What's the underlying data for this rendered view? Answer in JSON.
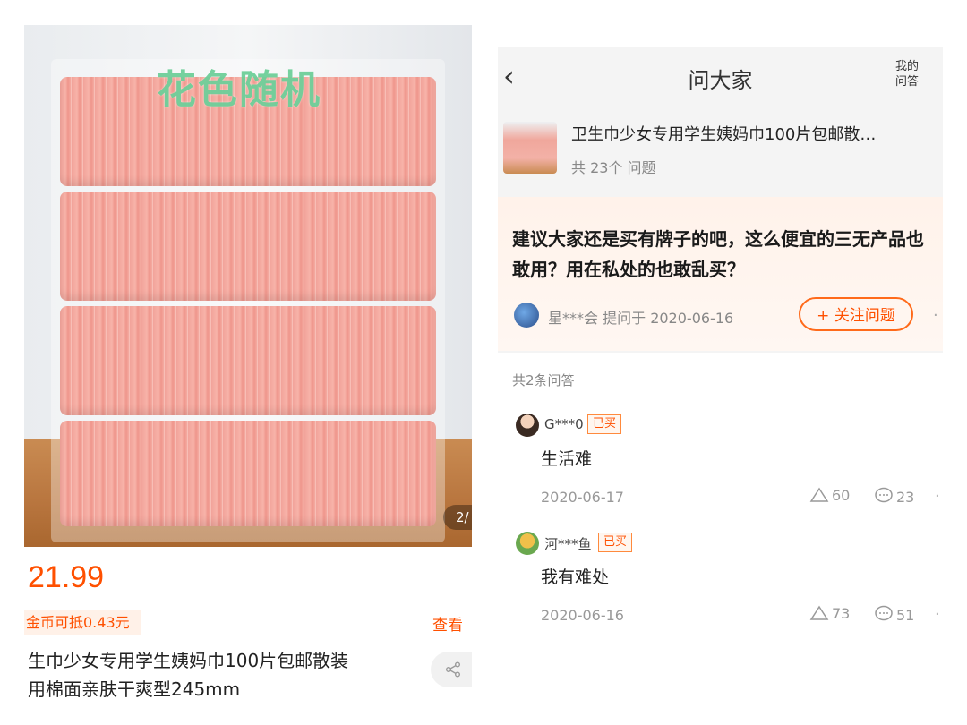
{
  "left": {
    "watermark": "花色随机",
    "page_indicator": "2/",
    "price": "21.99",
    "coin_text": "金币可抵0.43元",
    "look_all": "查看",
    "title_line1": "生巾少女专用学生姨妈巾100片包邮散装",
    "title_line2": "用棉面亲肤干爽型245mm"
  },
  "right": {
    "nav": {
      "back": "‹",
      "title": "问大家",
      "my_qa_line1": "我的",
      "my_qa_line2": "问答"
    },
    "product": {
      "title": "卫生巾少女专用学生姨妈巾100片包邮散…",
      "question_count": "共 23个 问题"
    },
    "question": {
      "text": "建议大家还是买有牌子的吧，这么便宜的三无产品也敢用？用在私处的也敢乱买？",
      "asker": "星***会",
      "asked_label": "提问于 2020-06-16",
      "follow_label": "+ 关注问题"
    },
    "answers_count": "共2条问答",
    "answers": [
      {
        "user": "G***0",
        "badge": "已买",
        "text": "生活难",
        "date": "2020-06-17",
        "likes": "60",
        "comments": "23"
      },
      {
        "user": "河***鱼",
        "badge": "已买",
        "text": "我有难处",
        "date": "2020-06-16",
        "likes": "73",
        "comments": "51"
      }
    ]
  },
  "colors": {
    "accent": "#ff5000",
    "watermark": "#6fcf9a",
    "pad": "#f2a39a"
  }
}
